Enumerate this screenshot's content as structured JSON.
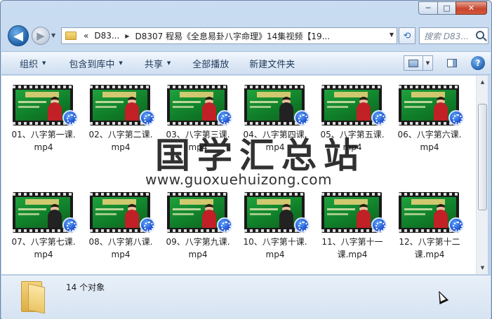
{
  "window": {
    "controls": {
      "minimize": "─",
      "maximize": "□",
      "close": "✕"
    }
  },
  "nav": {
    "back_glyph": "◀",
    "forward_glyph": "▶"
  },
  "address": {
    "overflow": "«",
    "segments": [
      "D83...",
      "D8307 程易《全息易卦八字命理》14集视频【19..."
    ]
  },
  "search": {
    "placeholder": "搜索 D83..."
  },
  "toolbar": {
    "organize": "组织",
    "include_library": "包含到库中",
    "share": "共享",
    "play_all": "全部播放",
    "new_folder": "新建文件夹",
    "help": "?"
  },
  "files": [
    {
      "name_line1": "01、八字第一课.",
      "name_line2": "mp4"
    },
    {
      "name_line1": "02、八字第二课.",
      "name_line2": "mp4"
    },
    {
      "name_line1": "03、八字第三课.",
      "name_line2": "mp4"
    },
    {
      "name_line1": "04、八字第四课.",
      "name_line2": "mp4"
    },
    {
      "name_line1": "05、八字第五课.",
      "name_line2": "mp4"
    },
    {
      "name_line1": "06、八字第六课.",
      "name_line2": "mp4"
    },
    {
      "name_line1": "07、八字第七课.",
      "name_line2": "mp4"
    },
    {
      "name_line1": "08、八字第八课.",
      "name_line2": "mp4"
    },
    {
      "name_line1": "09、八字第九课.",
      "name_line2": "mp4"
    },
    {
      "name_line1": "10、八字第十课.",
      "name_line2": "mp4"
    },
    {
      "name_line1": "11、八字第十一",
      "name_line2": "课.mp4"
    },
    {
      "name_line1": "12、八字第十二",
      "name_line2": "课.mp4"
    }
  ],
  "watermark": {
    "text": "国学汇总站",
    "url": "www.guoxuehuizong.com"
  },
  "status": {
    "count_text": "14 个对象"
  },
  "colors": {
    "accent": "#1e5fae",
    "thumb_green": "#1fa23c",
    "titlebar": "#c9dcf1"
  }
}
